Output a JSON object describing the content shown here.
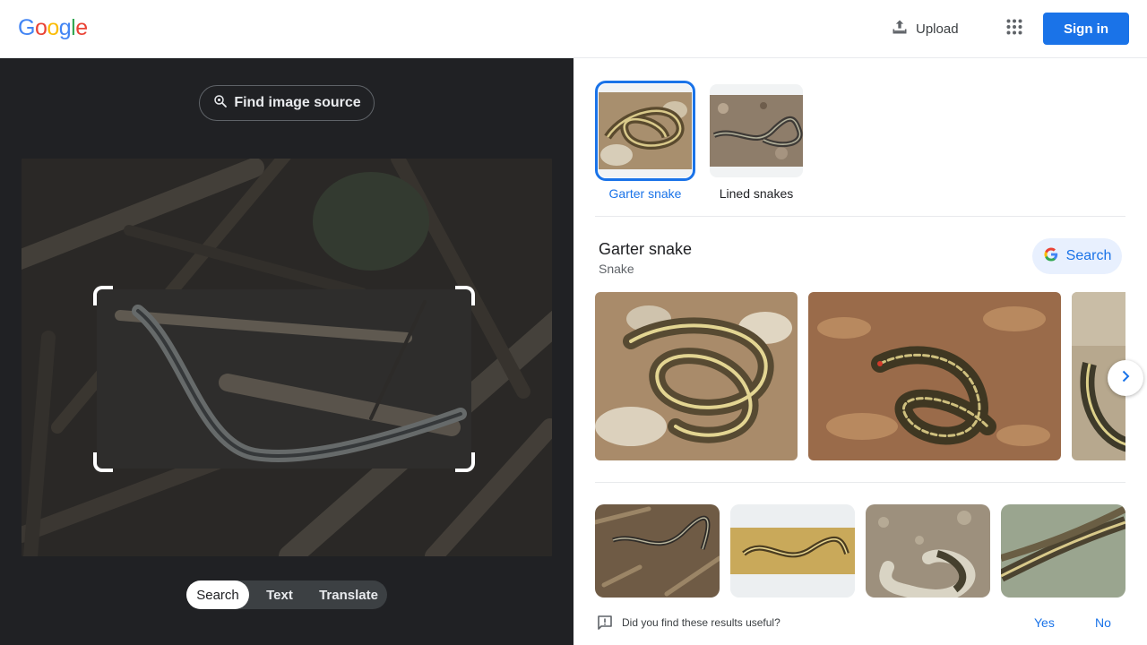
{
  "header": {
    "logo_letters": [
      {
        "char": "G",
        "color": "#4285F4"
      },
      {
        "char": "o",
        "color": "#EA4335"
      },
      {
        "char": "o",
        "color": "#FBBC05"
      },
      {
        "char": "g",
        "color": "#4285F4"
      },
      {
        "char": "l",
        "color": "#34A853"
      },
      {
        "char": "e",
        "color": "#EA4335"
      }
    ],
    "upload_label": "Upload",
    "upload_icon": "upload-icon",
    "apps_icon": "apps-grid-icon",
    "signin_label": "Sign in"
  },
  "left_pane": {
    "find_source_label": "Find image source",
    "find_source_icon": "lens-search-icon",
    "mode_tabs": [
      {
        "label": "Search",
        "active": true
      },
      {
        "label": "Text",
        "active": false
      },
      {
        "label": "Translate",
        "active": false
      }
    ]
  },
  "results": {
    "chips": [
      {
        "label": "Garter snake",
        "selected": true
      },
      {
        "label": "Lined snakes",
        "selected": false
      }
    ],
    "entity": {
      "title": "Garter snake",
      "subtitle": "Snake",
      "search_label": "Search"
    },
    "next_icon": "chevron-right-icon"
  },
  "feedback": {
    "question": "Did you find these results useful?",
    "yes_label": "Yes",
    "no_label": "No",
    "icon": "feedback-icon"
  },
  "colors": {
    "accent": "#1a73e8",
    "left_pane_bg": "#202124"
  }
}
